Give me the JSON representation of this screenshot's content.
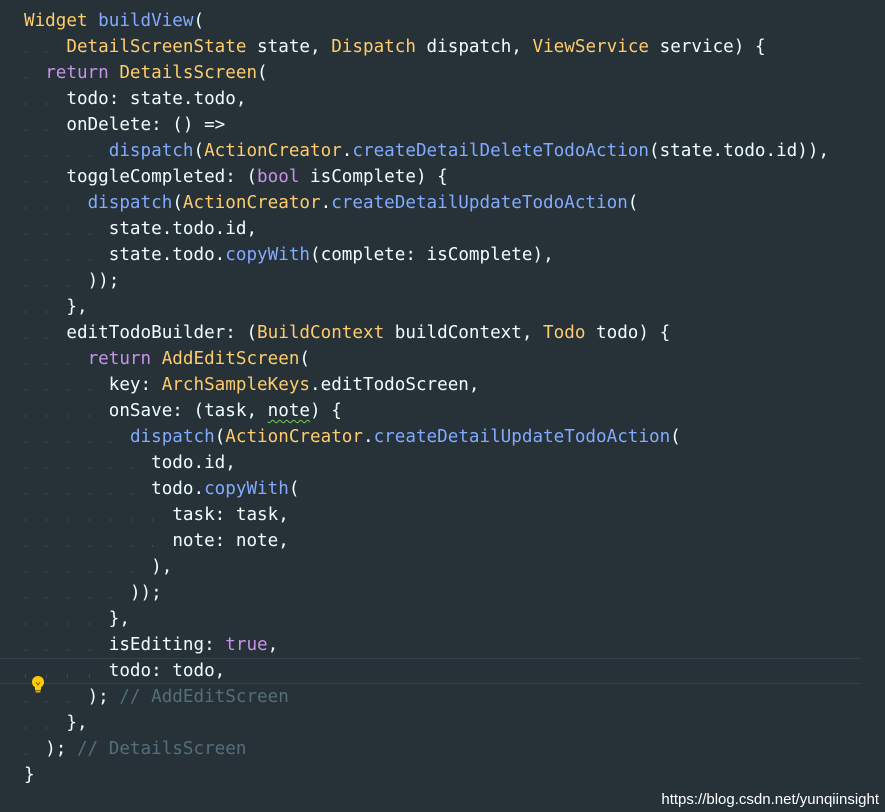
{
  "editor": {
    "theme_colors": {
      "background": "#263238",
      "keyword": "#c792ea",
      "type": "#ffcb6b",
      "function": "#82aaff",
      "text": "#eeffff",
      "comment": "#546e7a"
    },
    "lightbulb_icon": "lightbulb-icon",
    "current_line_index": 26,
    "lines": [
      [
        [
          "Widget ",
          "ty"
        ],
        [
          "buildView",
          "fn"
        ],
        [
          "(",
          "tx"
        ]
      ],
      [
        [
          "DetailScreenState",
          "ty"
        ],
        [
          " state, ",
          "tx"
        ],
        [
          "Dispatch",
          "ty"
        ],
        [
          " dispatch, ",
          "tx"
        ],
        [
          "ViewService",
          "ty"
        ],
        [
          " service) {",
          "tx"
        ]
      ],
      [
        [
          "return ",
          "kw"
        ],
        [
          "DetailsScreen",
          "ty"
        ],
        [
          "(",
          "tx"
        ]
      ],
      [
        [
          "todo: state.todo,",
          "tx"
        ]
      ],
      [
        [
          "onDelete: () =>",
          "tx"
        ]
      ],
      [
        [
          "dispatch",
          "fn"
        ],
        [
          "(",
          "tx"
        ],
        [
          "ActionCreator",
          "ty"
        ],
        [
          ".",
          "tx"
        ],
        [
          "createDetailDeleteTodoAction",
          "fn"
        ],
        [
          "(state.todo.id)),",
          "tx"
        ]
      ],
      [
        [
          "toggleCompleted: (",
          "tx"
        ],
        [
          "bool",
          "kw"
        ],
        [
          " isComplete) {",
          "tx"
        ]
      ],
      [
        [
          "dispatch",
          "fn"
        ],
        [
          "(",
          "tx"
        ],
        [
          "ActionCreator",
          "ty"
        ],
        [
          ".",
          "tx"
        ],
        [
          "createDetailUpdateTodoAction",
          "fn"
        ],
        [
          "(",
          "tx"
        ]
      ],
      [
        [
          "state.todo.id,",
          "tx"
        ]
      ],
      [
        [
          "state.todo.",
          "tx"
        ],
        [
          "copyWith",
          "fn"
        ],
        [
          "(complete: isComplete),",
          "tx"
        ]
      ],
      [
        [
          "));",
          "tx"
        ]
      ],
      [
        [
          "},",
          "tx"
        ]
      ],
      [
        [
          "editTodoBuilder: (",
          "tx"
        ],
        [
          "BuildContext",
          "ty"
        ],
        [
          " buildContext, ",
          "tx"
        ],
        [
          "Todo",
          "ty"
        ],
        [
          " todo) {",
          "tx"
        ]
      ],
      [
        [
          "return ",
          "kw"
        ],
        [
          "AddEditScreen",
          "ty"
        ],
        [
          "(",
          "tx"
        ]
      ],
      [
        [
          "key: ",
          "tx"
        ],
        [
          "ArchSampleKeys",
          "ty"
        ],
        [
          ".editTodoScreen,",
          "tx"
        ]
      ],
      [
        [
          "onSave: (task, ",
          "tx"
        ],
        [
          "note",
          "sq"
        ],
        [
          ") {",
          "tx"
        ]
      ],
      [
        [
          "dispatch",
          "fn"
        ],
        [
          "(",
          "tx"
        ],
        [
          "ActionCreator",
          "ty"
        ],
        [
          ".",
          "tx"
        ],
        [
          "createDetailUpdateTodoAction",
          "fn"
        ],
        [
          "(",
          "tx"
        ]
      ],
      [
        [
          "todo.id,",
          "tx"
        ]
      ],
      [
        [
          "todo.",
          "tx"
        ],
        [
          "copyWith",
          "fn"
        ],
        [
          "(",
          "tx"
        ]
      ],
      [
        [
          "task: task,",
          "tx"
        ]
      ],
      [
        [
          "note: note,",
          "tx"
        ]
      ],
      [
        [
          "),",
          "tx"
        ]
      ],
      [
        [
          "));",
          "tx"
        ]
      ],
      [
        [
          "},",
          "tx"
        ]
      ],
      [
        [
          "isEditing: ",
          "tx"
        ],
        [
          "true",
          "kw"
        ],
        [
          ",",
          "tx"
        ]
      ],
      [
        [
          "todo: todo,",
          "tx"
        ]
      ],
      [
        [
          "); ",
          "tx"
        ],
        [
          "// AddEditScreen",
          "cm"
        ]
      ],
      [
        [
          "},",
          "tx"
        ]
      ],
      [
        [
          "); ",
          "tx"
        ],
        [
          "// DetailsScreen",
          "cm"
        ]
      ],
      [
        [
          "}",
          "tx"
        ]
      ]
    ]
  },
  "watermark": "https://blog.csdn.net/yunqiinsight"
}
